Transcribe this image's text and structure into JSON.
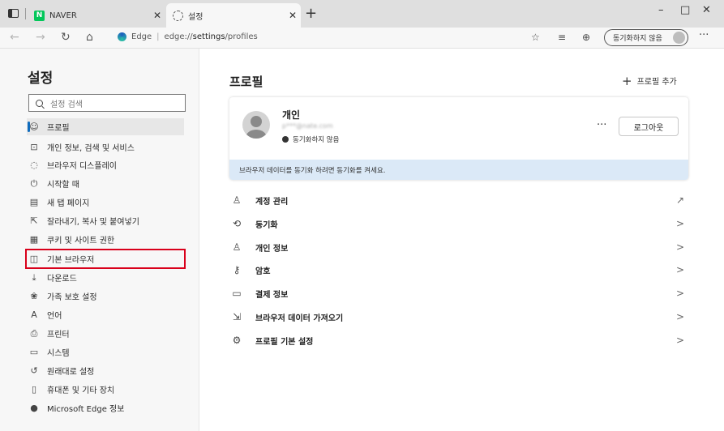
{
  "tabs": [
    {
      "title": "NAVER",
      "logo": "N"
    },
    {
      "title": "설정"
    }
  ],
  "window_controls": {
    "minimize": "–",
    "maximize": "□",
    "close": "✕"
  },
  "address": {
    "site": "Edge",
    "url_prefix": "edge://",
    "url_path": "settings",
    "url_suffix": "/profiles"
  },
  "sync_button_label": "동기화하지 않음",
  "sidebar": {
    "title": "설정",
    "search_placeholder": "설정 검색",
    "items": [
      {
        "label": "프로필",
        "icon": "profile-icon"
      },
      {
        "label": "개인 정보, 검색 및 서비스",
        "icon": "lock-icon"
      },
      {
        "label": "브라우저 디스플레이",
        "icon": "palette-icon"
      },
      {
        "label": "시작할 때",
        "icon": "power-icon"
      },
      {
        "label": "새 탭 페이지",
        "icon": "newtab-icon"
      },
      {
        "label": "잘라내기, 복사 및 붙여넣기",
        "icon": "share-icon"
      },
      {
        "label": "쿠키 및 사이트 권한",
        "icon": "cookie-icon"
      },
      {
        "label": "기본 브라우저",
        "icon": "browser-icon"
      },
      {
        "label": "다운로드",
        "icon": "download-icon"
      },
      {
        "label": "가족 보호 설정",
        "icon": "family-icon"
      },
      {
        "label": "언어",
        "icon": "language-icon"
      },
      {
        "label": "프린터",
        "icon": "printer-icon"
      },
      {
        "label": "시스템",
        "icon": "system-icon"
      },
      {
        "label": "원래대로 설정",
        "icon": "reset-icon"
      },
      {
        "label": "휴대폰 및 기타 장치",
        "icon": "phone-icon"
      },
      {
        "label": "Microsoft Edge 정보",
        "icon": "edge-icon"
      }
    ]
  },
  "main": {
    "title": "프로필",
    "add_profile_label": "프로필 추가",
    "profile": {
      "name": "개인",
      "email": "p***@nate.com",
      "sync_status": "동기화하지 않음",
      "more": "···",
      "logout_label": "로그아웃",
      "banner": "브라우저 데이터를 동기화 하려면 동기화를 켜세요."
    },
    "rows": [
      {
        "label": "계정 관리",
        "icon": "account-icon",
        "trail": "↗"
      },
      {
        "label": "동기화",
        "icon": "sync-icon",
        "trail": ">"
      },
      {
        "label": "개인 정보",
        "icon": "personal-info-icon",
        "trail": ">"
      },
      {
        "label": "암호",
        "icon": "key-icon",
        "trail": ">"
      },
      {
        "label": "결제 정보",
        "icon": "card-icon",
        "trail": ">"
      },
      {
        "label": "브라우저 데이터 가져오기",
        "icon": "import-icon",
        "trail": ">"
      },
      {
        "label": "프로필 기본 설정",
        "icon": "profile-settings-icon",
        "trail": ">"
      }
    ]
  }
}
